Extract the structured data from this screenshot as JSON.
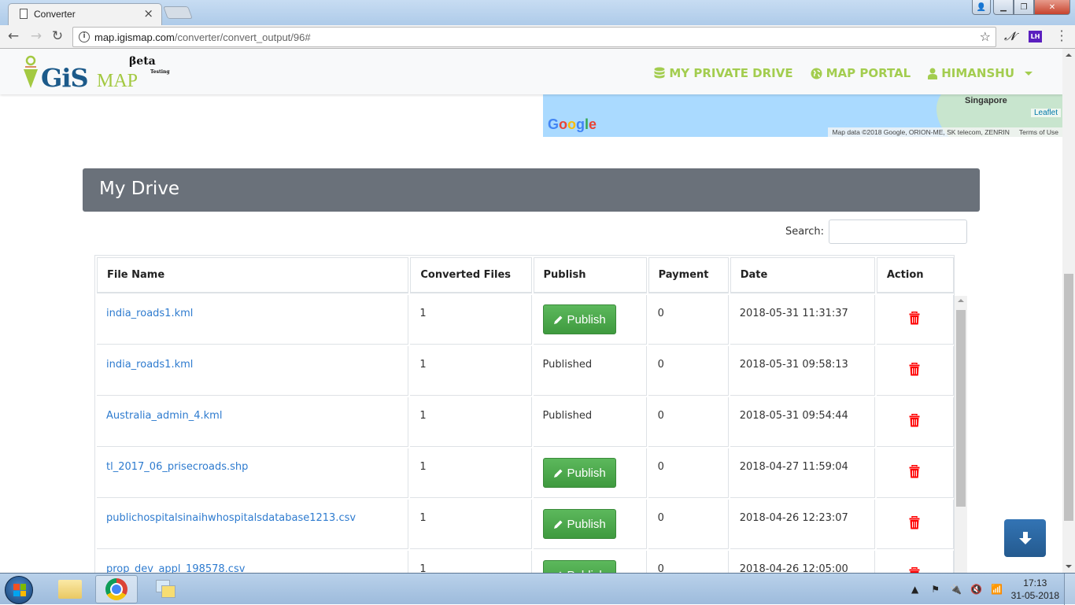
{
  "browser": {
    "tab_title": "Converter",
    "url_host": "map.igismap.com",
    "url_path": "/converter/convert_output/96#",
    "extension_lh": "LH"
  },
  "navbar": {
    "logo_text_gis": "GiS",
    "logo_text_map": "MAP",
    "logo_beta": "βeta",
    "logo_testing": "Testing",
    "links": [
      {
        "label": "MY PRIVATE DRIVE",
        "icon": "database-icon"
      },
      {
        "label": "MAP PORTAL",
        "icon": "globe-icon"
      },
      {
        "label": "HIMANSHU",
        "icon": "user-icon"
      }
    ]
  },
  "map": {
    "place_label": "Singapore",
    "google_logo": "Google",
    "leaflet_attr": "Leaflet",
    "map_data": "Map data ©2018 Google, ORION-ME, SK telecom, ZENRIN",
    "terms": "Terms of Use"
  },
  "drive": {
    "title": "My Drive",
    "search_label": "Search:",
    "search_value": "",
    "columns": [
      "File Name",
      "Converted Files",
      "Publish",
      "Payment",
      "Date",
      "Action"
    ],
    "publish_label": "Publish",
    "rows": [
      {
        "file": "india_roads1.kml",
        "converted": "1",
        "publish": "button",
        "published_text": "",
        "payment": "0",
        "date": "2018-05-31 11:31:37"
      },
      {
        "file": "india_roads1.kml",
        "converted": "1",
        "publish": "text",
        "published_text": "Published",
        "payment": "0",
        "date": "2018-05-31 09:58:13"
      },
      {
        "file": "Australia_admin_4.kml",
        "converted": "1",
        "publish": "text",
        "published_text": "Published",
        "payment": "0",
        "date": "2018-05-31 09:54:44"
      },
      {
        "file": "tl_2017_06_prisecroads.shp",
        "converted": "1",
        "publish": "button",
        "published_text": "",
        "payment": "0",
        "date": "2018-04-27 11:59:04"
      },
      {
        "file": "publichospitalsinaihwhospitalsdatabase1213.csv",
        "converted": "1",
        "publish": "button",
        "published_text": "",
        "payment": "0",
        "date": "2018-04-26 12:23:07"
      },
      {
        "file": "prop_dev_appl_198578.csv",
        "converted": "1",
        "publish": "button",
        "published_text": "",
        "payment": "0",
        "date": "2018-04-26 12:05:00"
      }
    ]
  },
  "colors": {
    "brand_green": "#a3cd4f",
    "header_gray": "#6a717a",
    "link_blue": "#2e7bcf",
    "publish_green": "#4cae4c",
    "delete_red": "#ff0000",
    "scroll_button_blue": "#2d6aa6"
  },
  "taskbar": {
    "time": "17:13",
    "date": "31-05-2018"
  }
}
